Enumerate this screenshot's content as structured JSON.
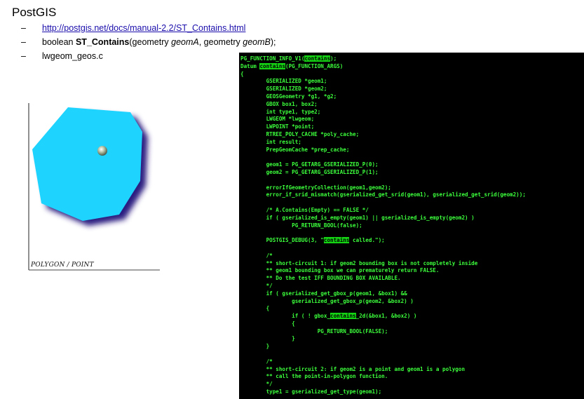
{
  "title": "PostGIS",
  "bullets": {
    "dash": "–",
    "link": "http://postgis.net/docs/manual-2.2/ST_Contains.html",
    "sig": {
      "type": "boolean ",
      "fname": "ST_Contains",
      "open": "(geometry ",
      "argA": "geomA",
      "mid": ", geometry ",
      "argB": "geomB",
      "close": ");"
    },
    "file": "lwgeom_geos.c"
  },
  "figure": {
    "caption": "POLYGON / POINT",
    "polygon_color": "#1fd3ff",
    "shadow_color": "#2a1a80"
  },
  "code": {
    "highlight_word": "contains",
    "accent": "#3cff3c",
    "lines": [
      "PG_FUNCTION_INFO_V1(@contains@);",
      "Datum @contains@(PG_FUNCTION_ARGS)",
      "{",
      "        GSERIALIZED *geom1;",
      "        GSERIALIZED *geom2;",
      "        GEOSGeometry *g1, *g2;",
      "        GBOX box1, box2;",
      "        int type1, type2;",
      "        LWGEOM *lwgeom;",
      "        LWPOINT *point;",
      "        RTREE_POLY_CACHE *poly_cache;",
      "        int result;",
      "        PrepGeomCache *prep_cache;",
      "",
      "        geom1 = PG_GETARG_GSERIALIZED_P(0);",
      "        geom2 = PG_GETARG_GSERIALIZED_P(1);",
      "",
      "        errorIfGeometryCollection(geom1,geom2);",
      "        error_if_srid_mismatch(gserialized_get_srid(geom1), gserialized_get_srid(geom2));",
      "",
      "        /* A.Contains(Empty) == FALSE */",
      "        if ( gserialized_is_empty(geom1) || gserialized_is_empty(geom2) )",
      "                PG_RETURN_BOOL(false);",
      "",
      "        POSTGIS_DEBUG(3, \"@contains@ called.\");",
      "",
      "        /*",
      "        ** short-circuit 1: if geom2 bounding box is not completely inside",
      "        ** geom1 bounding box we can prematurely return FALSE.",
      "        ** Do the test IFF BOUNDING BOX AVAILABLE.",
      "        */",
      "        if ( gserialized_get_gbox_p(geom1, &box1) &&",
      "                gserialized_get_gbox_p(geom2, &box2) )",
      "        {",
      "                if ( ! gbox_@contains@_2d(&box1, &box2) )",
      "                {",
      "                        PG_RETURN_BOOL(FALSE);",
      "                }",
      "        }",
      "",
      "        /*",
      "        ** short-circuit 2: if geom2 is a point and geom1 is a polygon",
      "        ** call the point-in-polygon function.",
      "        */",
      "        type1 = gserialized_get_type(geom1);"
    ]
  }
}
